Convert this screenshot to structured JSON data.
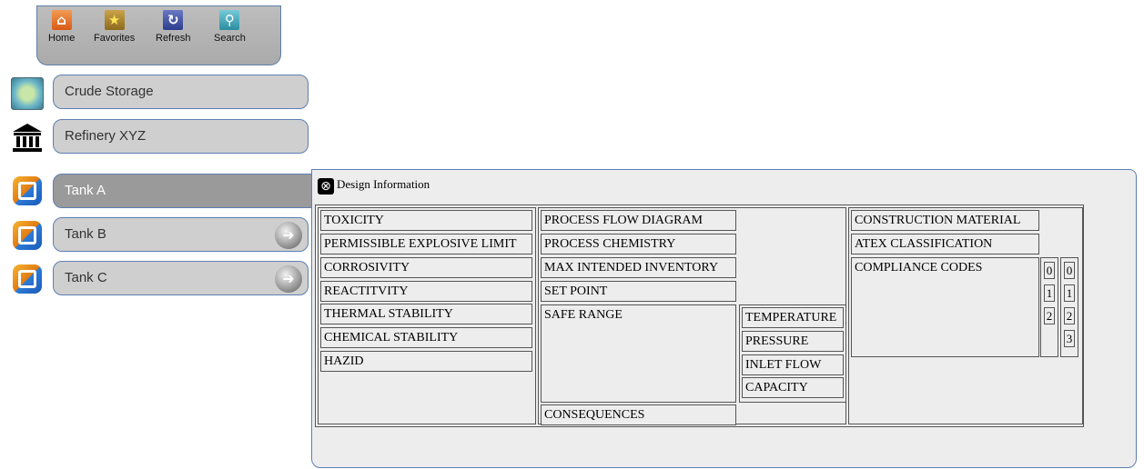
{
  "toolbar": {
    "home": "Home",
    "favorites": "Favorites",
    "refresh": "Refresh",
    "search": "Search"
  },
  "nav": {
    "crude": "Crude Storage",
    "refinery": "Refinery XYZ",
    "tanks": [
      "Tank A",
      "Tank B",
      "Tank C"
    ]
  },
  "panel": {
    "title": "Design Information",
    "col1": [
      "TOXICITY",
      "PERMISSIBLE EXPLOSIVE LIMIT",
      "CORROSIVITY",
      "REACTITVITY",
      "THERMAL STABILITY",
      "CHEMICAL STABILITY",
      "HAZID"
    ],
    "col2": [
      "PROCESS FLOW DIAGRAM",
      "PROCESS CHEMISTRY",
      "MAX INTENDED INVENTORY",
      "SET POINT"
    ],
    "safe_range": "SAFE RANGE",
    "safe_range_items": [
      "TEMPERATURE",
      "PRESSURE",
      "INLET FLOW",
      "CAPACITY"
    ],
    "consequences": "CONSEQUENCES",
    "col3": [
      "CONSTRUCTION MATERIAL",
      "ATEX CLASSIFICATION"
    ],
    "compliance": "COMPLIANCE CODES",
    "codes_a": [
      "0",
      "1",
      "2"
    ],
    "codes_b": [
      "0",
      "1",
      "2",
      "3"
    ]
  }
}
